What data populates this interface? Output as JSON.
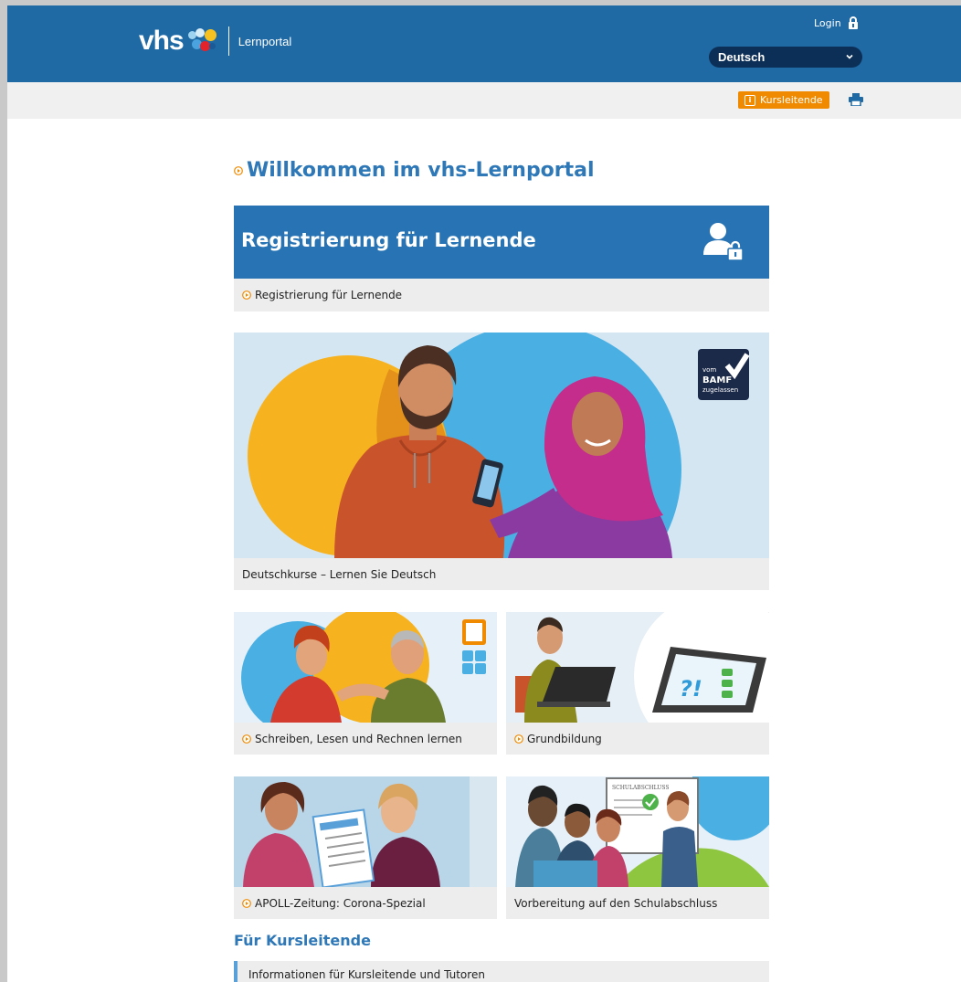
{
  "header": {
    "logo_text": "vhs",
    "portal_name": "Lernportal",
    "login_label": "Login",
    "language": "Deutsch"
  },
  "toolbar": {
    "kursleitende_label": "Kursleitende"
  },
  "main": {
    "title": "Willkommen im vhs-Lernportal",
    "registration": {
      "banner_title": "Registrierung für Lernende",
      "link_label": "Registrierung für Lernende"
    },
    "deutschkurse": {
      "label": "Deutschkurse – Lernen Sie Deutsch",
      "badge_line1": "vom",
      "badge_line2": "BAMF",
      "badge_line3": "zugelassen"
    },
    "cards": [
      {
        "label": "Schreiben, Lesen und Rechnen lernen"
      },
      {
        "label": "Grundbildung"
      },
      {
        "label": "APOLL-Zeitung: Corona-Spezial"
      },
      {
        "label": "Vorbereitung auf den Schulabschluss",
        "board_text": "SCHULABSCHLUSS"
      }
    ],
    "kursleitende_section": {
      "heading": "Für Kursleitende",
      "info_link": "Informationen für Kursleitende und Tutoren"
    }
  },
  "colors": {
    "header_blue": "#1f6aa5",
    "accent_orange": "#f08a00",
    "title_blue": "#2f78b7"
  }
}
